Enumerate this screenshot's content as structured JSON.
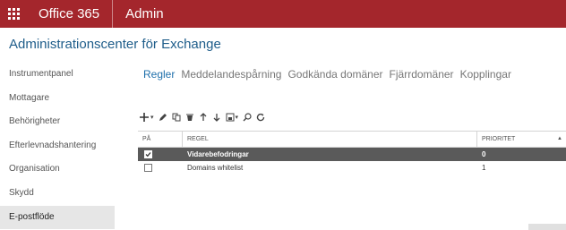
{
  "suitebar": {
    "title": "Office 365",
    "app": "Admin",
    "accent": "#a4262c"
  },
  "page_title": "Administrationscenter för Exchange",
  "leftnav": {
    "items": [
      {
        "label": "Instrumentpanel",
        "selected": false
      },
      {
        "label": "Mottagare",
        "selected": false
      },
      {
        "label": "Behörigheter",
        "selected": false
      },
      {
        "label": "Efterlevnadshantering",
        "selected": false
      },
      {
        "label": "Organisation",
        "selected": false
      },
      {
        "label": "Skydd",
        "selected": false
      },
      {
        "label": "E-postflöde",
        "selected": true
      }
    ]
  },
  "tabs": [
    {
      "label": "Regler",
      "active": true
    },
    {
      "label": "Meddelandespårning",
      "active": false
    },
    {
      "label": "Godkända domäner",
      "active": false
    },
    {
      "label": "Fjärrdomäner",
      "active": false
    },
    {
      "label": "Kopplingar",
      "active": false
    }
  ],
  "toolbar": {
    "icons": [
      "add-icon",
      "edit-icon",
      "copy-icon",
      "delete-icon",
      "move-up-icon",
      "move-down-icon",
      "export-icon",
      "search-icon",
      "refresh-icon"
    ]
  },
  "grid": {
    "columns": [
      "PÅ",
      "REGEL",
      "PRIORITET"
    ],
    "sort_indicator": "▲",
    "rows": [
      {
        "on": true,
        "rule": "Vidarebefodringar",
        "priority": "0",
        "selected": true
      },
      {
        "on": false,
        "rule": "Domains whitelist",
        "priority": "1",
        "selected": false
      }
    ]
  }
}
